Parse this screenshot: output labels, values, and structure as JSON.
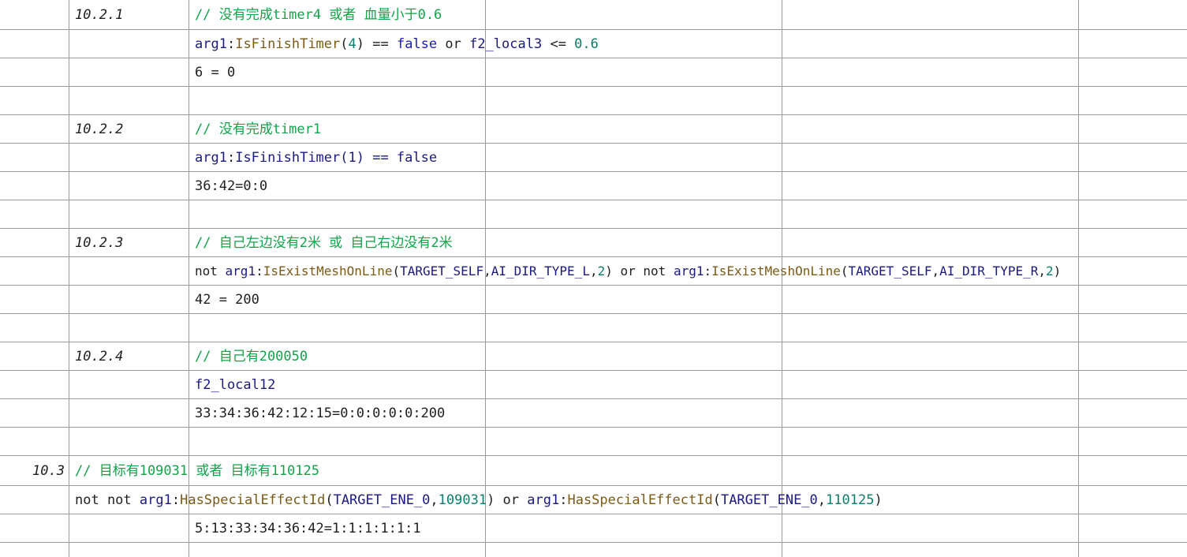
{
  "rows": [
    {
      "id": "10.2.1",
      "comment": "// 没有完成timer4 或者 血量小于0.6"
    },
    {
      "code": [
        "arg1",
        ":",
        "IsFinishTimer",
        "(",
        "4",
        ") == ",
        "false",
        " or ",
        "f2_local3",
        " <= ",
        "0.6"
      ]
    },
    {
      "plain": "6 = 0"
    },
    {},
    {
      "id": "10.2.2",
      "comment": "// 没有完成timer1"
    },
    {
      "code": [
        "arg1",
        ":",
        "IsFinishTimer",
        "(1) == false"
      ]
    },
    {
      "plain": "36:42=0:0"
    },
    {},
    {
      "id": "10.2.3",
      "comment": "// 自己左边没有2米 或 自己右边没有2米"
    },
    {
      "code": [
        "not ",
        "arg1",
        ":",
        "IsExistMeshOnLine",
        "(",
        "TARGET_SELF",
        ",",
        "AI_DIR_TYPE_L",
        ",",
        "2",
        ") or not ",
        "arg1",
        ":",
        "IsExistMeshOnLine",
        "(",
        "TARGET_SELF",
        ",",
        "AI_DIR_TYPE_R",
        ",",
        "2",
        ")"
      ]
    },
    {
      "plain": "42 = 200"
    },
    {},
    {
      "id": "10.2.4",
      "comment": "// 自己有200050"
    },
    {
      "code": [
        "f2_local12"
      ]
    },
    {
      "plain": "33:34:36:42:12:15=0:0:0:0:0:200"
    },
    {},
    {
      "id_outer": "10.3",
      "comment": "// 目标有109031 或者 目标有110125"
    },
    {
      "code_outer": [
        "not not ",
        "arg1",
        ":",
        "HasSpecialEffectId",
        "(",
        "TARGET_ENE_0",
        ",",
        "109031",
        ") or ",
        "arg1",
        ":",
        "HasSpecialEffectId",
        "(",
        "TARGET_ENE_0",
        ",",
        "110125",
        ")"
      ]
    },
    {
      "plain": "5:13:33:34:36:42=1:1:1:1:1:1"
    }
  ]
}
